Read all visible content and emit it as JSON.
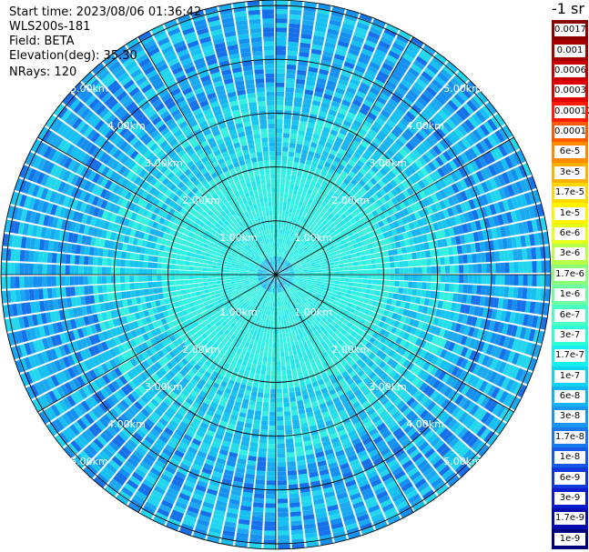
{
  "info": {
    "start_time": "Start time: 2023/08/06 01:36:42",
    "instrument": "WLS200s-181",
    "field": "Field: BETA",
    "elevation": "Elevation(deg): 35.30",
    "nrays": "NRays: 120"
  },
  "colorbar": {
    "unit_label": "-1 sr",
    "levels": [
      {
        "label": "0.0017",
        "color": "#8c0000"
      },
      {
        "label": "0.001",
        "color": "#a50000"
      },
      {
        "label": "0.0006",
        "color": "#c80000"
      },
      {
        "label": "0.0003",
        "color": "#e10000"
      },
      {
        "label": "0.00017",
        "color": "#ff1c00"
      },
      {
        "label": "0.0001",
        "color": "#ff5a00"
      },
      {
        "label": "6e-5",
        "color": "#ff8a00"
      },
      {
        "label": "3e-5",
        "color": "#ffb000"
      },
      {
        "label": "1.7e-5",
        "color": "#ffd800"
      },
      {
        "label": "1e-5",
        "color": "#fff200"
      },
      {
        "label": "6e-6",
        "color": "#e8ff1a"
      },
      {
        "label": "3e-6",
        "color": "#b8ff4a"
      },
      {
        "label": "1.7e-6",
        "color": "#8cff7a"
      },
      {
        "label": "1e-6",
        "color": "#6dffa0"
      },
      {
        "label": "6e-7",
        "color": "#4cffc0"
      },
      {
        "label": "3e-7",
        "color": "#2cffd8"
      },
      {
        "label": "1.7e-7",
        "color": "#16f0ee"
      },
      {
        "label": "1e-7",
        "color": "#12d2f2"
      },
      {
        "label": "6e-8",
        "color": "#14b4f4"
      },
      {
        "label": "3e-8",
        "color": "#1a96f2"
      },
      {
        "label": "1.7e-8",
        "color": "#1a78ee"
      },
      {
        "label": "1e-8",
        "color": "#1658e8"
      },
      {
        "label": "6e-9",
        "color": "#1038dc"
      },
      {
        "label": "3e-9",
        "color": "#0a1ccc"
      },
      {
        "label": "1.7e-9",
        "color": "#040cb0"
      },
      {
        "label": "1e-9",
        "color": "#00007c"
      }
    ]
  },
  "chart_data": {
    "type": "heatmap",
    "subtype": "ppi-polar",
    "rings_km": [
      1,
      2,
      3,
      4,
      5
    ],
    "ring_labels": [
      "1.00km",
      "2.00km",
      "3.00km",
      "4.00km",
      "5.00km"
    ],
    "radial_lines_deg": [
      0,
      30,
      60,
      90,
      120,
      150,
      180,
      210,
      240,
      270,
      300,
      330
    ],
    "n_rays": 120,
    "max_range_km": 5.1,
    "range_zones": [
      {
        "from_km": 0.0,
        "to_km": 0.35,
        "palette": [
          "#1fb9f0",
          "#1ad6ee",
          "#2fe7e7",
          "#0f99f0"
        ]
      },
      {
        "from_km": 0.35,
        "to_km": 2.1,
        "palette": [
          "#33f0e0",
          "#2bf3e6",
          "#3ef0dc",
          "#22e6ec"
        ]
      },
      {
        "from_km": 2.1,
        "to_km": 3.4,
        "palette": [
          "#22dcea",
          "#16c6f0",
          "#33f0e0",
          "#18b4f2"
        ]
      },
      {
        "from_km": 3.4,
        "to_km": 5.1,
        "palette": [
          "#1aa8f0",
          "#1590f0",
          "#16c0f2",
          "#1670ea",
          "#22d6ee"
        ]
      }
    ]
  }
}
